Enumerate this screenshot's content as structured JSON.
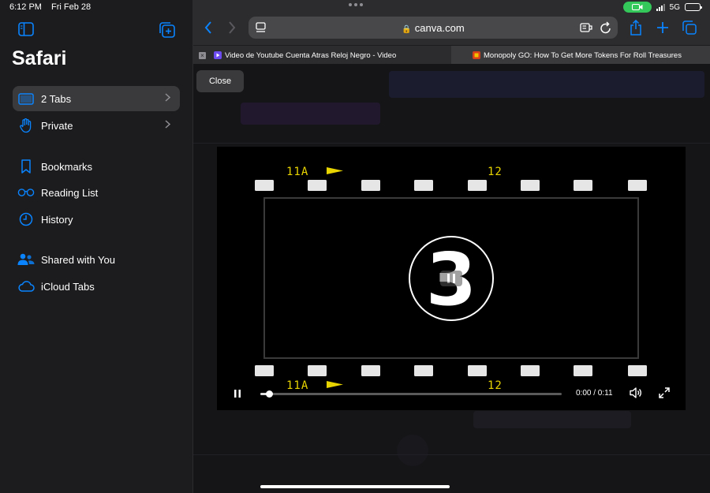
{
  "status": {
    "time": "6:12 PM",
    "date": "Fri Feb 28",
    "network": "5G"
  },
  "sidebar": {
    "title": "Safari",
    "tab_groups": [
      {
        "label": "2 Tabs",
        "icon": "tabs-icon",
        "selected": true
      },
      {
        "label": "Private",
        "icon": "hand-icon",
        "selected": false
      }
    ],
    "items": [
      {
        "label": "Bookmarks",
        "icon": "bookmark-icon"
      },
      {
        "label": "Reading List",
        "icon": "glasses-icon"
      },
      {
        "label": "History",
        "icon": "clock-icon"
      },
      {
        "label": "Shared with You",
        "icon": "people-icon"
      },
      {
        "label": "iCloud Tabs",
        "icon": "cloud-icon"
      }
    ]
  },
  "toolbar": {
    "url": "canva.com"
  },
  "tabs": [
    {
      "title": "Video de Youtube Cuenta Atras Reloj Negro - Video",
      "active": true
    },
    {
      "title": "Monopoly GO: How To Get More Tokens For Roll Treasures",
      "active": false
    }
  ],
  "overlay": {
    "close_label": "Close"
  },
  "video": {
    "film_labels_top": [
      "11A",
      "12"
    ],
    "film_labels_bottom": [
      "11A",
      "12"
    ],
    "countdown_number": "3",
    "current_time": "0:00",
    "duration": "0:11",
    "time_display": "0:00 / 0:11",
    "progress": 0.03
  },
  "colors": {
    "accent": "#0a84ff",
    "call_green": "#34c759",
    "film_yellow": "#e8d400"
  }
}
